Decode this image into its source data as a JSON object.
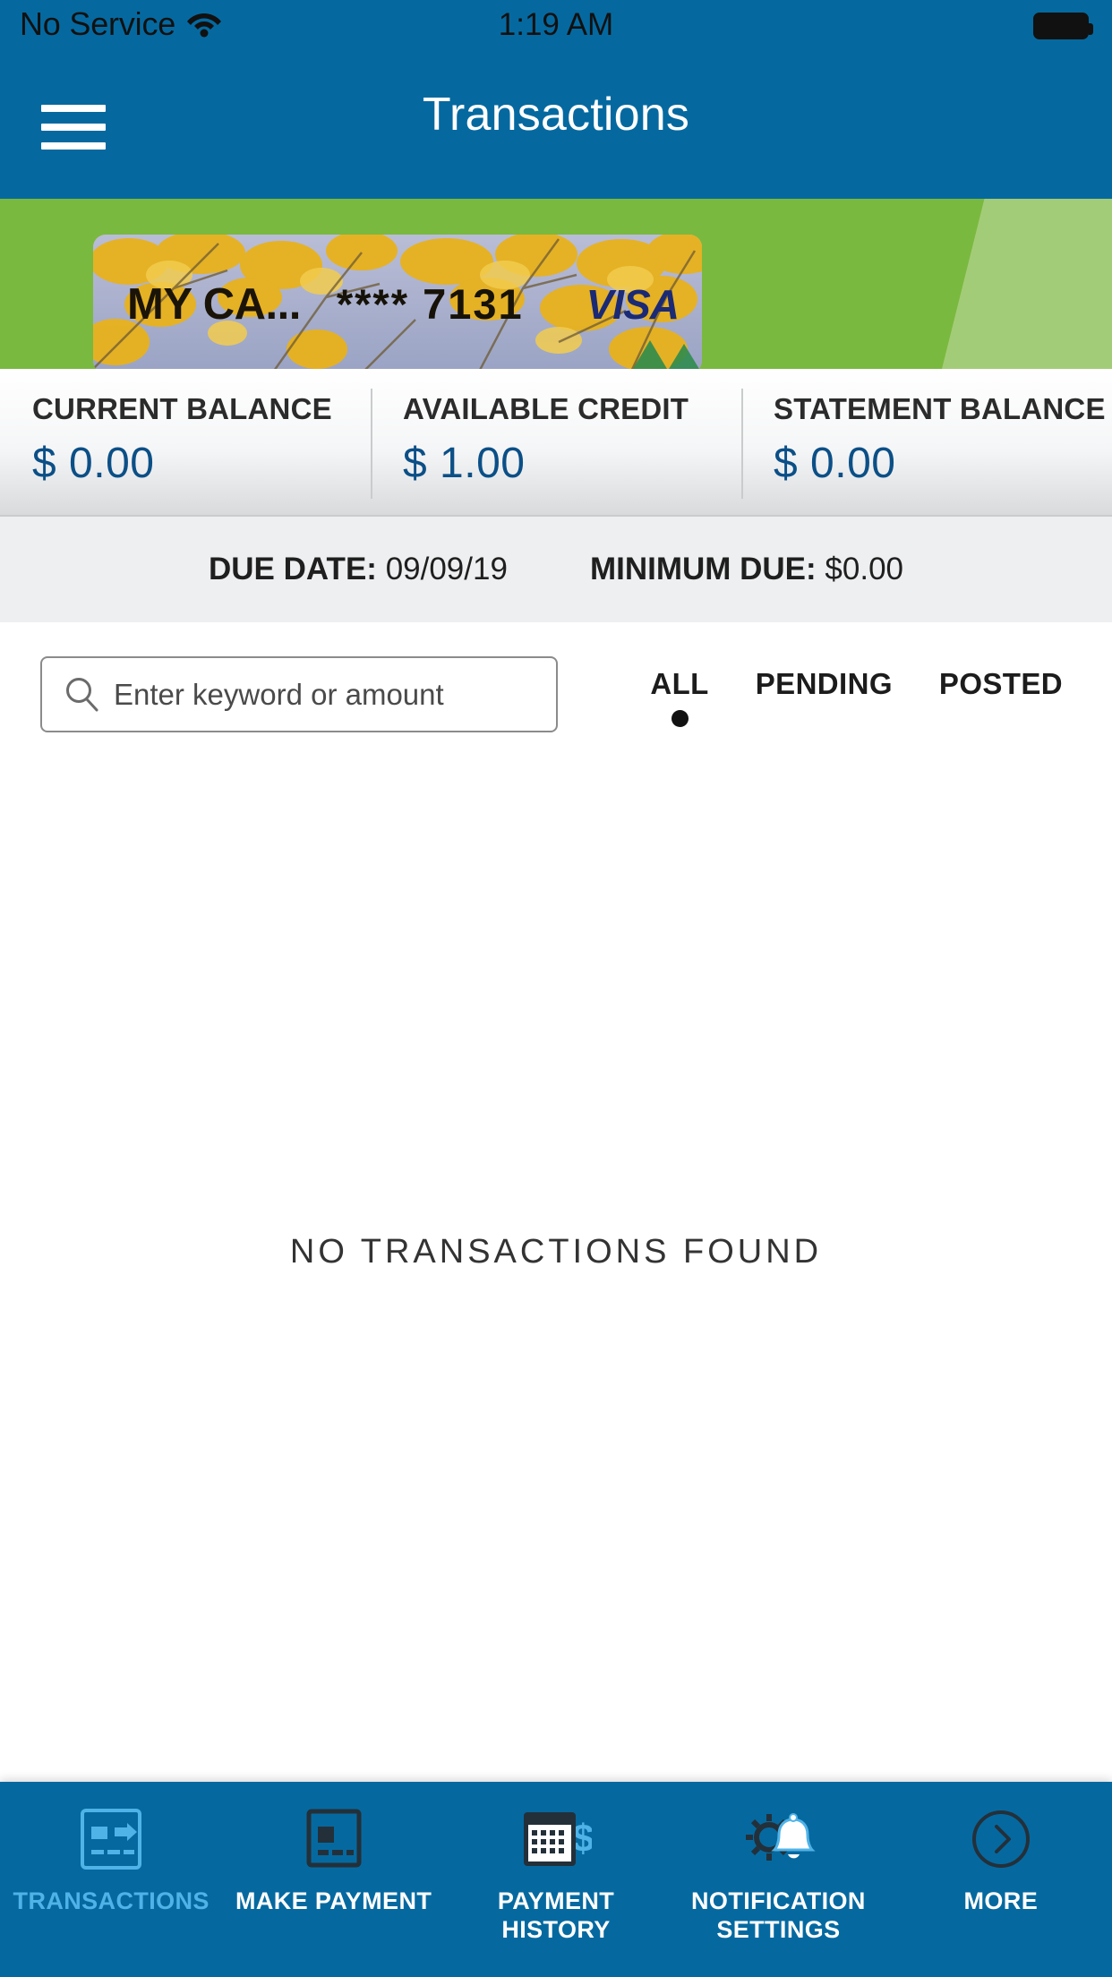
{
  "status_bar": {
    "carrier": "No Service",
    "time": "1:19 AM",
    "wifi_icon": "wifi-icon",
    "battery_icon": "battery-full-icon"
  },
  "nav": {
    "menu_icon": "hamburger-menu-icon",
    "title": "Transactions"
  },
  "card": {
    "nickname": "MY CA...",
    "masked_number": "**** 7131",
    "network": "VISA",
    "artwork": "autumn-tree-photo"
  },
  "balances": [
    {
      "label": "CURRENT BALANCE",
      "value": "$ 0.00"
    },
    {
      "label": "AVAILABLE CREDIT",
      "value": "$ 1.00"
    },
    {
      "label": "STATEMENT BALANCE",
      "value": "$ 0.00"
    }
  ],
  "due": {
    "due_date_label": "DUE DATE:",
    "due_date_value": "09/09/19",
    "minimum_due_label": "MINIMUM DUE:",
    "minimum_due_value": "$0.00"
  },
  "search": {
    "placeholder": "Enter keyword or amount",
    "value": "",
    "icon": "search-icon"
  },
  "filter_tabs": [
    {
      "label": "ALL",
      "selected": true
    },
    {
      "label": "PENDING",
      "selected": false
    },
    {
      "label": "POSTED",
      "selected": false
    }
  ],
  "list": {
    "empty_message": "NO TRANSACTIONS FOUND"
  },
  "bottom_tabs": [
    {
      "label": "TRANSACTIONS",
      "icon": "card-transfer-icon",
      "active": true
    },
    {
      "label": "MAKE PAYMENT",
      "icon": "credit-card-icon",
      "active": false
    },
    {
      "label": "PAYMENT HISTORY",
      "icon": "calendar-dollar-icon",
      "active": false
    },
    {
      "label": "NOTIFICATION SETTINGS",
      "icon": "gear-bell-icon",
      "active": false
    },
    {
      "label": "MORE",
      "icon": "chevron-right-circle-icon",
      "active": false
    }
  ],
  "colors": {
    "header_blue": "#0569a0",
    "hero_green": "#7ab93f",
    "hero_green_light": "#a3cc78",
    "balance_value_blue": "#0b4f87",
    "active_tab_blue": "#4fb3e8",
    "visa_blue": "#1a2a75"
  }
}
